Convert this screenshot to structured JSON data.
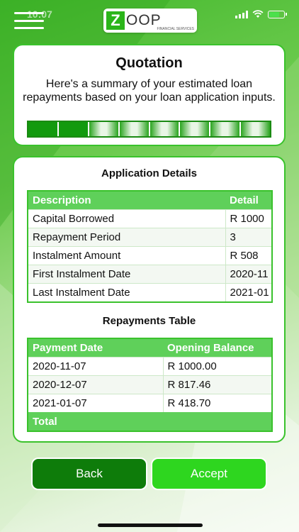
{
  "status": {
    "time": "10:07"
  },
  "logo": {
    "mark": "Z",
    "name": "OOP",
    "sub": "FINANCIAL SERVICES"
  },
  "quotation": {
    "title": "Quotation",
    "description": "Here's a summary of your estimated loan repayments based on your loan application inputs.",
    "progress": {
      "completed_steps": 2,
      "total_steps": 8
    }
  },
  "application_details": {
    "title": "Application Details",
    "headers": [
      "Description",
      "Detail"
    ],
    "rows": [
      [
        "Capital Borrowed",
        "R 1000"
      ],
      [
        "Repayment Period",
        "3"
      ],
      [
        "Instalment Amount",
        "R 508"
      ],
      [
        "First Instalment Date",
        "2020-11"
      ],
      [
        "Last Instalment Date",
        "2021-01"
      ]
    ]
  },
  "repayments": {
    "title": "Repayments Table",
    "headers": [
      "Payment Date",
      "Opening Balance"
    ],
    "rows": [
      [
        "2020-11-07",
        "R 1000.00"
      ],
      [
        "2020-12-07",
        "R 817.46"
      ],
      [
        "2021-01-07",
        "R 418.70"
      ]
    ],
    "total_label": "Total"
  },
  "buttons": {
    "back": "Back",
    "accept": "Accept"
  },
  "colors": {
    "primary": "#3ac22c",
    "dark": "#0e7c0a",
    "accent": "#2ed61f"
  }
}
